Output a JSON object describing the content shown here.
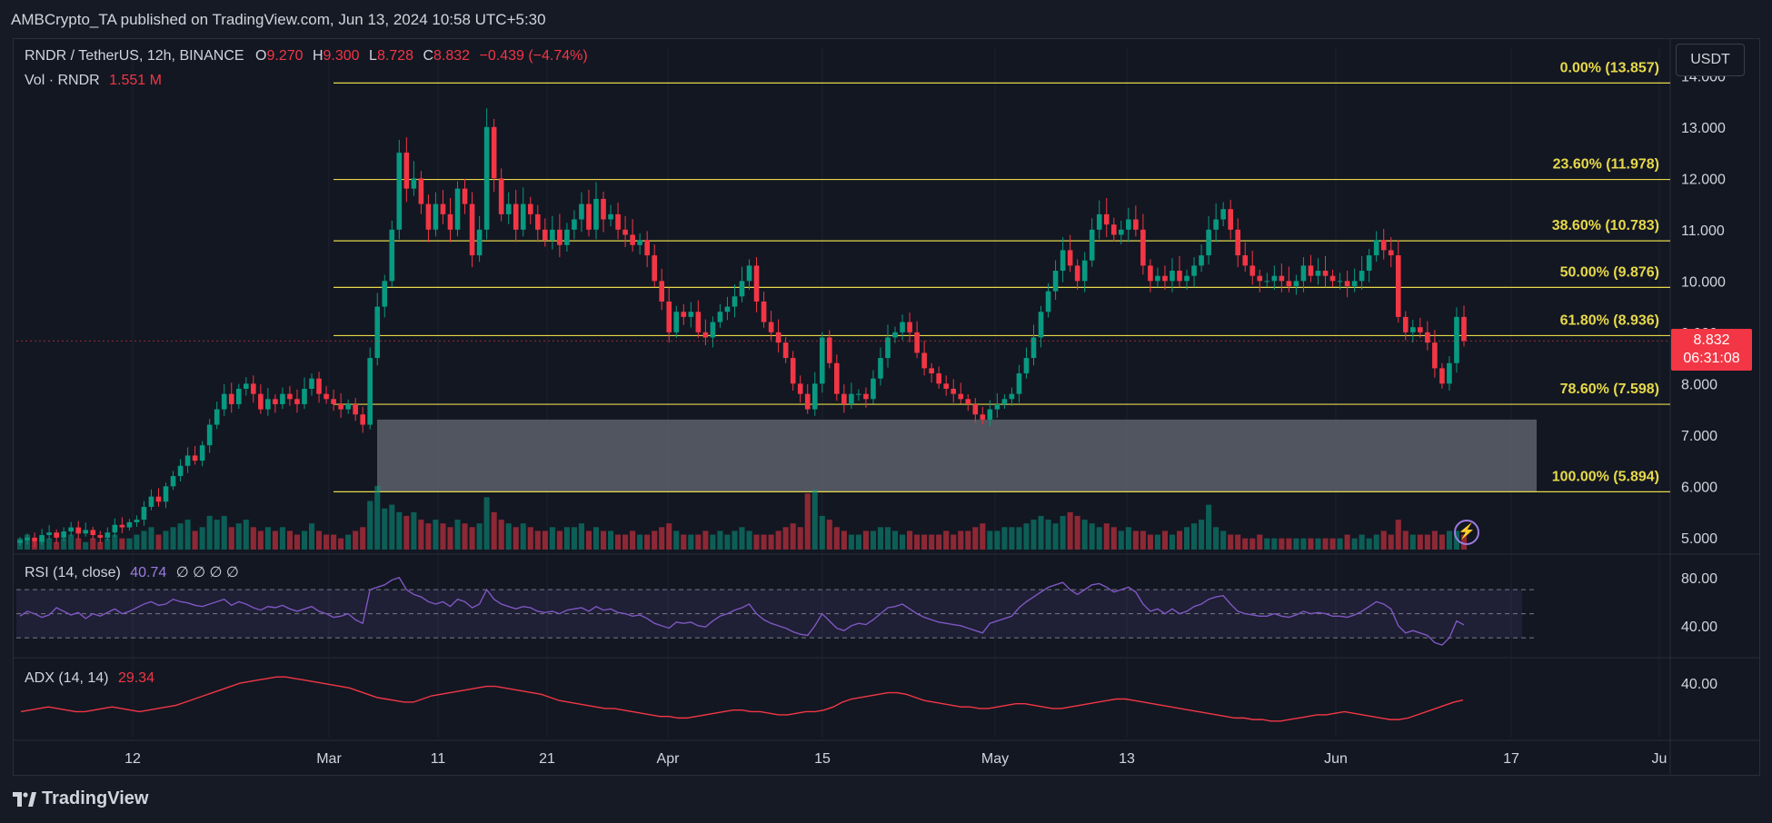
{
  "header": {
    "publisher": "AMBCrypto_TA published on TradingView.com, Jun 13, 2024 10:58 UTC+5:30"
  },
  "legend": {
    "symbol": "RNDR / TetherUS, 12h, BINANCE",
    "o_label": "O",
    "o_value": "9.270",
    "h_label": "H",
    "h_value": "9.300",
    "l_label": "L",
    "l_value": "8.728",
    "c_label": "C",
    "c_value": "8.832",
    "change": "−0.439 (−4.74%)",
    "vol_label": "Vol · RNDR",
    "vol_value": "1.551 M"
  },
  "currency_button": "USDT",
  "last_price": {
    "price": "8.832",
    "countdown": "06:31:08"
  },
  "rsi": {
    "label": "RSI (14, close)",
    "value": "40.74",
    "extras": "∅ ∅ ∅ ∅"
  },
  "adx": {
    "label": "ADX (14, 14)",
    "value": "29.34"
  },
  "footer": {
    "brand": "TradingView",
    "logo_icon": "tradingview-logo-icon"
  },
  "colors": {
    "up": "#089981",
    "down": "#f23645",
    "fib": "#e6d84a",
    "rsi_line": "#7e57c2",
    "adx_line": "#f23645",
    "zone": "#5d606b"
  },
  "chart_data": [
    {
      "type": "candlestick",
      "symbol": "RNDR / TetherUS",
      "interval": "12h",
      "x_ticks": [
        "12",
        "Mar",
        "11",
        "21",
        "Apr",
        "15",
        "May",
        "13",
        "Jun",
        "17",
        "Ju"
      ],
      "y_ticks": [
        "14.000",
        "13.000",
        "12.000",
        "11.000",
        "10.000",
        "9.000",
        "8.000",
        "7.000",
        "6.000",
        "5.000"
      ],
      "ylim": [
        4.75,
        14.2
      ],
      "fib_levels": [
        {
          "label": "0.00% (13.857)",
          "price": 13.857
        },
        {
          "label": "23.60% (11.978)",
          "price": 11.978
        },
        {
          "label": "38.60% (10.783)",
          "price": 10.783
        },
        {
          "label": "50.00% (9.876)",
          "price": 9.876
        },
        {
          "label": "61.80% (8.936)",
          "price": 8.936
        },
        {
          "label": "78.60% (7.598)",
          "price": 7.598
        },
        {
          "label": "100.00% (5.894)",
          "price": 5.894
        }
      ],
      "demand_zone": {
        "from": 5.894,
        "to": 7.3
      },
      "closes": [
        4.95,
        5.0,
        4.92,
        5.05,
        5.1,
        5.0,
        5.12,
        5.2,
        5.08,
        5.15,
        5.05,
        5.0,
        5.1,
        5.25,
        5.2,
        5.3,
        5.35,
        5.6,
        5.8,
        5.7,
        6.0,
        6.2,
        6.4,
        6.6,
        6.5,
        6.8,
        7.2,
        7.5,
        7.8,
        7.6,
        7.9,
        8.0,
        7.8,
        7.5,
        7.7,
        7.6,
        7.8,
        7.7,
        7.6,
        7.9,
        8.1,
        7.8,
        7.7,
        7.6,
        7.5,
        7.6,
        7.4,
        7.2,
        8.5,
        9.5,
        10.0,
        11.0,
        12.5,
        11.8,
        12.0,
        11.5,
        11.0,
        11.5,
        11.3,
        11.0,
        11.8,
        11.5,
        10.5,
        11.0,
        13.0,
        12.0,
        11.3,
        11.5,
        11.0,
        11.5,
        11.3,
        11.0,
        10.8,
        11.0,
        10.7,
        11.0,
        11.2,
        11.5,
        11.0,
        11.6,
        11.2,
        11.3,
        11.0,
        10.9,
        10.7,
        10.8,
        10.5,
        10.0,
        9.6,
        9.0,
        9.4,
        9.3,
        9.4,
        9.0,
        8.9,
        9.2,
        9.4,
        9.5,
        9.7,
        10.0,
        10.3,
        9.6,
        9.2,
        9.0,
        8.8,
        8.5,
        8.0,
        7.8,
        7.5,
        8.0,
        8.9,
        8.4,
        7.8,
        7.6,
        7.8,
        7.8,
        7.7,
        8.1,
        8.5,
        8.9,
        9.0,
        9.2,
        9.0,
        8.6,
        8.3,
        8.2,
        8.0,
        7.9,
        7.8,
        7.7,
        7.6,
        7.4,
        7.3,
        7.5,
        7.6,
        7.7,
        7.8,
        8.2,
        8.5,
        8.9,
        9.4,
        9.8,
        10.2,
        10.6,
        10.3,
        10.0,
        10.4,
        11.0,
        11.3,
        11.1,
        10.9,
        11.0,
        11.2,
        11.0,
        10.3,
        10.0,
        10.1,
        10.0,
        10.2,
        10.0,
        10.1,
        10.3,
        10.5,
        11.0,
        11.2,
        11.4,
        11.0,
        10.5,
        10.3,
        10.1,
        10.0,
        10.0,
        10.1,
        10.0,
        9.9,
        10.0,
        10.3,
        10.1,
        10.2,
        10.1,
        10.0,
        10.0,
        9.9,
        10.0,
        10.2,
        10.5,
        10.8,
        10.6,
        10.5,
        9.3,
        9.0,
        9.1,
        9.0,
        8.8,
        8.3,
        8.0,
        8.4,
        9.3,
        8.832
      ],
      "volume_max_hint": "relative",
      "volumes": [
        3,
        4,
        2,
        3,
        3,
        2,
        3,
        4,
        3,
        2,
        3,
        2,
        3,
        4,
        3,
        3,
        4,
        5,
        6,
        4,
        5,
        6,
        7,
        8,
        5,
        6,
        9,
        8,
        9,
        6,
        7,
        8,
        6,
        5,
        6,
        5,
        6,
        5,
        4,
        5,
        7,
        5,
        4,
        4,
        3,
        4,
        5,
        6,
        13,
        17,
        11,
        12,
        10,
        9,
        10,
        8,
        7,
        8,
        7,
        6,
        8,
        7,
        6,
        7,
        14,
        10,
        8,
        7,
        6,
        7,
        6,
        5,
        5,
        6,
        5,
        6,
        6,
        7,
        5,
        6,
        5,
        5,
        4,
        4,
        5,
        4,
        4,
        5,
        6,
        7,
        5,
        4,
        4,
        4,
        5,
        4,
        5,
        4,
        5,
        6,
        5,
        4,
        4,
        4,
        5,
        6,
        7,
        6,
        15,
        16,
        9,
        8,
        6,
        5,
        4,
        4,
        5,
        5,
        6,
        6,
        5,
        4,
        5,
        4,
        4,
        4,
        4,
        5,
        4,
        5,
        5,
        6,
        7,
        5,
        5,
        6,
        6,
        6,
        7,
        8,
        9,
        8,
        7,
        9,
        10,
        9,
        8,
        7,
        6,
        7,
        6,
        5,
        6,
        5,
        5,
        4,
        4,
        5,
        4,
        5,
        6,
        7,
        8,
        12,
        6,
        5,
        4,
        4,
        3,
        3,
        4,
        3,
        3,
        3,
        3,
        3,
        3,
        3,
        3,
        3,
        3,
        3,
        4,
        3,
        4,
        3,
        4,
        5,
        4,
        8,
        5,
        4,
        4,
        4,
        5,
        4,
        5,
        5,
        4
      ]
    },
    {
      "type": "line",
      "name": "RSI (14, close)",
      "y_ticks": [
        "80.00",
        "40.00"
      ],
      "ylim": [
        15,
        98
      ],
      "bands": [
        70,
        50,
        30
      ],
      "values": [
        48,
        52,
        50,
        47,
        49,
        55,
        52,
        49,
        51,
        46,
        50,
        48,
        51,
        54,
        50,
        52,
        55,
        58,
        60,
        57,
        58,
        62,
        60,
        59,
        57,
        56,
        58,
        60,
        62,
        57,
        60,
        58,
        55,
        53,
        56,
        55,
        57,
        54,
        52,
        54,
        56,
        52,
        50,
        47,
        48,
        50,
        45,
        42,
        70,
        72,
        74,
        78,
        80,
        70,
        66,
        64,
        60,
        58,
        60,
        56,
        62,
        60,
        55,
        58,
        70,
        62,
        58,
        56,
        54,
        56,
        55,
        52,
        51,
        52,
        50,
        53,
        54,
        55,
        52,
        56,
        53,
        54,
        51,
        50,
        48,
        49,
        46,
        42,
        40,
        38,
        43,
        42,
        43,
        40,
        39,
        44,
        48,
        50,
        53,
        55,
        58,
        50,
        45,
        42,
        40,
        38,
        35,
        33,
        32,
        40,
        50,
        44,
        38,
        36,
        40,
        42,
        41,
        45,
        50,
        55,
        56,
        58,
        54,
        50,
        47,
        45,
        43,
        42,
        41,
        40,
        38,
        36,
        34,
        42,
        44,
        46,
        48,
        55,
        60,
        64,
        68,
        72,
        74,
        76,
        70,
        66,
        70,
        74,
        75,
        72,
        68,
        70,
        72,
        68,
        58,
        52,
        54,
        50,
        54,
        50,
        52,
        56,
        58,
        62,
        64,
        65,
        58,
        52,
        50,
        49,
        48,
        48,
        50,
        48,
        47,
        49,
        52,
        50,
        51,
        50,
        48,
        48,
        47,
        49,
        52,
        56,
        60,
        58,
        54,
        40,
        34,
        36,
        34,
        32,
        26,
        24,
        30,
        44,
        40.74
      ]
    },
    {
      "type": "line",
      "name": "ADX (14, 14)",
      "y_ticks": [
        "40.00"
      ],
      "ylim": [
        5,
        55
      ],
      "values": [
        22,
        23,
        24,
        25,
        24,
        23,
        22,
        22,
        23,
        24,
        25,
        24,
        23,
        22,
        23,
        24,
        25,
        26,
        28,
        30,
        32,
        34,
        36,
        38,
        40,
        41,
        42,
        43,
        44,
        44,
        43,
        42,
        41,
        40,
        39,
        38,
        37,
        35,
        33,
        31,
        30,
        29,
        28,
        28,
        30,
        32,
        33,
        34,
        35,
        36,
        37,
        38,
        38,
        37,
        36,
        35,
        34,
        33,
        31,
        29,
        28,
        27,
        26,
        25,
        24,
        24,
        23,
        22,
        21,
        20,
        19,
        19,
        18,
        18,
        19,
        20,
        21,
        22,
        23,
        23,
        22,
        22,
        21,
        20,
        20,
        21,
        22,
        22,
        23,
        25,
        28,
        30,
        31,
        32,
        33,
        34,
        34,
        33,
        31,
        29,
        28,
        27,
        26,
        25,
        25,
        24,
        24,
        25,
        26,
        27,
        27,
        26,
        25,
        24,
        24,
        25,
        26,
        27,
        28,
        29,
        30,
        30,
        29,
        28,
        27,
        26,
        25,
        24,
        23,
        22,
        21,
        20,
        19,
        18,
        18,
        17,
        17,
        16,
        16,
        17,
        18,
        19,
        20,
        20,
        21,
        22,
        21,
        20,
        19,
        18,
        17,
        17,
        18,
        20,
        22,
        24,
        26,
        28,
        29.34
      ]
    }
  ]
}
